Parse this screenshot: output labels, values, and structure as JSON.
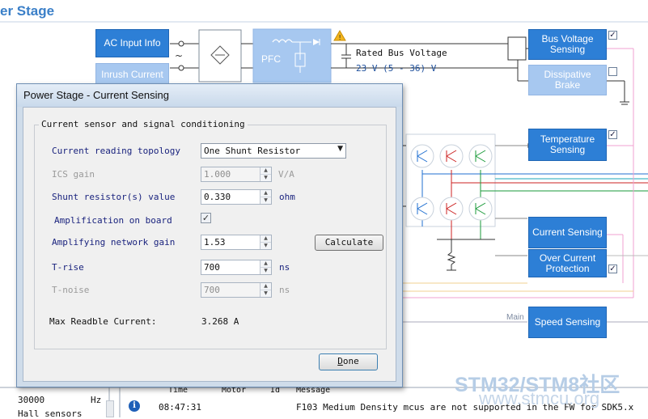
{
  "page": {
    "title": "er Stage"
  },
  "blocks": {
    "ac_input": "AC Input Info",
    "inrush": "Inrush Current",
    "pfc": "PFC",
    "bus_voltage": "Bus Voltage Sensing",
    "dissipative": "Dissipative Brake",
    "temperature": "Temperature Sensing",
    "current": "Current Sensing",
    "over_current": "Over Current Protection",
    "speed": "Speed Sensing"
  },
  "bus": {
    "label": "Rated Bus Voltage",
    "value": "23 V (5 - 36) V"
  },
  "main_label": "Main",
  "checks": {
    "bus_voltage": true,
    "dissipative": false,
    "temperature": true,
    "over_current": true
  },
  "dialog": {
    "title": "Power Stage - Current Sensing",
    "group_title": "Current sensor and signal conditioning",
    "topology_label": "Current reading topology",
    "topology_value": "One Shunt Resistor",
    "ics_gain_label": "ICS gain",
    "ics_gain_value": "1.000",
    "ics_gain_unit": "V/A",
    "shunt_label": "Shunt resistor(s) value",
    "shunt_value": "0.330",
    "shunt_unit": "ohm",
    "amp_board_label": "Amplification on board",
    "amp_board_checked": true,
    "amp_gain_label": "Amplifying network gain",
    "amp_gain_value": "1.53",
    "calculate_label": "Calculate",
    "trise_label": "T-rise",
    "trise_value": "700",
    "trise_unit": "ns",
    "tnoise_label": "T-noise",
    "tnoise_value": "700",
    "tnoise_unit": "ns",
    "max_label": "Max Readble Current:",
    "max_value": "3.268 A",
    "done_label": "Done"
  },
  "bottom": {
    "freq_value": "30000",
    "freq_unit": "Hz",
    "hall_label": "Hall sensors",
    "log_headers": [
      "Time",
      "Motor",
      "Id",
      "Message"
    ],
    "log_row": {
      "time": "08:47:31",
      "message": "F103 Medium Density mcus are not supported in the FW for SDK5.x"
    }
  },
  "watermark": {
    "line1": "STM32/STM8社区",
    "line2": "www.stmcu.org"
  },
  "colors": {
    "accent": "#2d7fd6",
    "accent_light": "#a7c8f0",
    "title": "#3a7fc8"
  }
}
